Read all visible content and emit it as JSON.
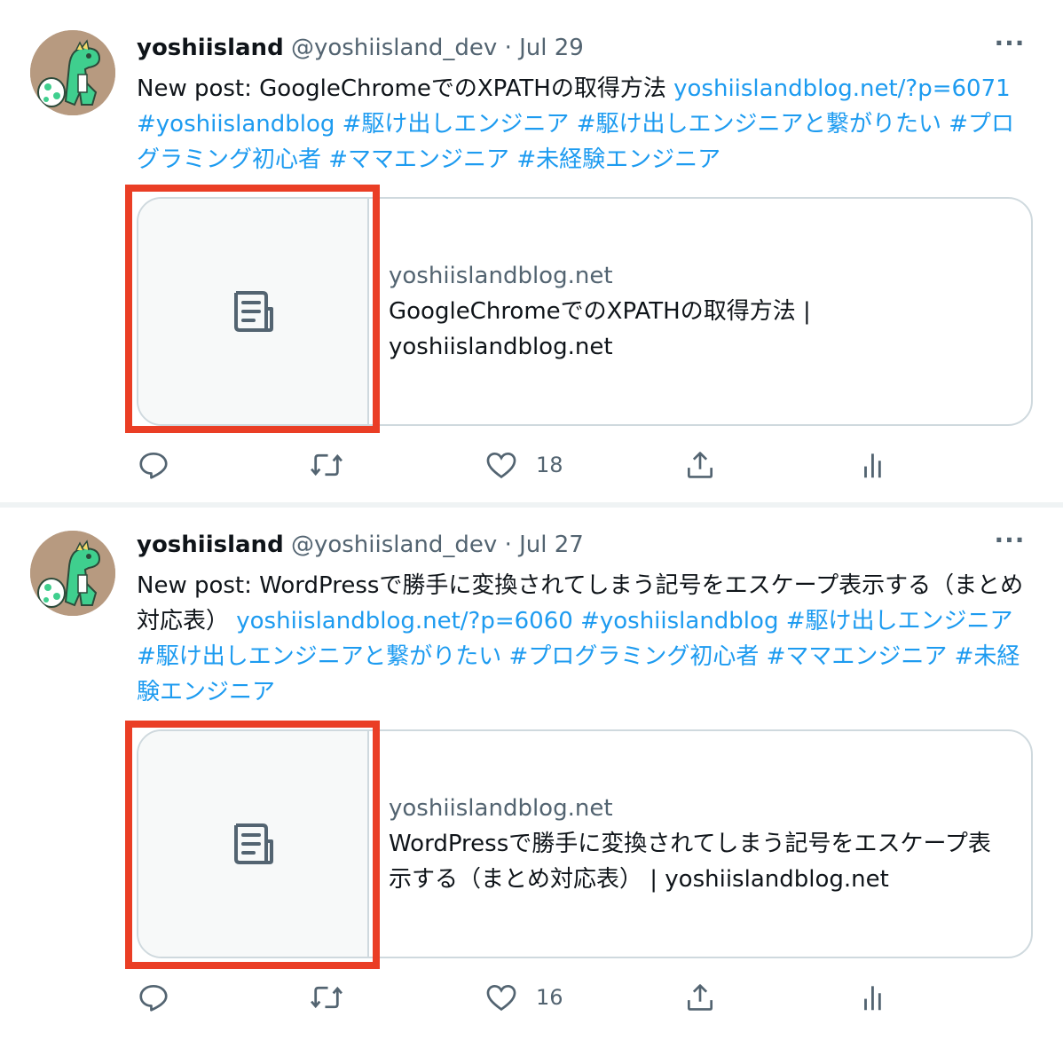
{
  "tweets": [
    {
      "display_name": "yoshiisland",
      "handle": "@yoshiisland_dev",
      "separator": "·",
      "date": "Jul 29",
      "more_label": "···",
      "text_plain": "New post: GoogleChromeでのXPATHの取得方法 ",
      "text_links": "yoshiislandblog.net/?p=6071  #yoshiislandblog #駆け出しエンジニア #駆け出しエンジニアと繋がりたい #プログラミング初心者 #ママエンジニア #未経験エンジニア",
      "card": {
        "domain": "yoshiislandblog.net",
        "title": "GoogleChromeでのXPATHの取得方法 | yoshiislandblog.net",
        "thumb_icon": "article-icon"
      },
      "actions": {
        "reply_count": "",
        "retweet_count": "",
        "like_count": "18",
        "share_count": "",
        "analytics_count": ""
      }
    },
    {
      "display_name": "yoshiisland",
      "handle": "@yoshiisland_dev",
      "separator": "·",
      "date": "Jul 27",
      "more_label": "···",
      "text_plain": "New post: WordPressで勝手に変換されてしまう記号をエスケープ表示する（まとめ対応表） ",
      "text_links": "yoshiislandblog.net/?p=6060  #yoshiislandblog #駆け出しエンジニア #駆け出しエンジニアと繋がりたい #プログラミング初心者 #ママエンジニア #未経験エンジニア",
      "card": {
        "domain": "yoshiislandblog.net",
        "title": "WordPressで勝手に変換されてしまう記号をエスケープ表示する（まとめ対応表） | yoshiislandblog.net",
        "thumb_icon": "article-icon"
      },
      "actions": {
        "reply_count": "",
        "retweet_count": "",
        "like_count": "16",
        "share_count": "",
        "analytics_count": ""
      }
    }
  ],
  "colors": {
    "link": "#1d9bf0",
    "highlight": "#ea3e25",
    "muted": "#536471",
    "border": "#cfd9de"
  }
}
